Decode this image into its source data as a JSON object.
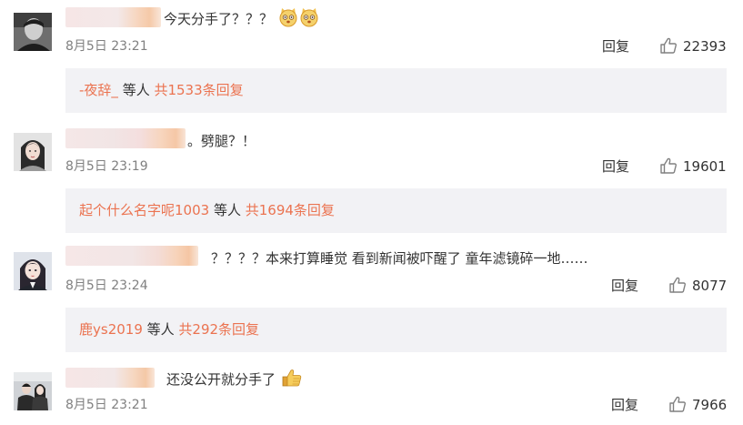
{
  "comments": [
    {
      "text": "今天分手了？？？",
      "timestamp": "8月5日 23:21",
      "reply_label": "回复",
      "likes": "22393",
      "emoji": [
        "cat-face-icon",
        "cat-face-icon"
      ],
      "replies_preview": {
        "user": "-夜辞_",
        "middle": " 等人 ",
        "total": "共1533条回复"
      }
    },
    {
      "text": "。劈腿？！",
      "timestamp": "8月5日 23:19",
      "reply_label": "回复",
      "likes": "19601",
      "replies_preview": {
        "user": "起个什么名字呢1003",
        "middle": " 等人 ",
        "total": "共1694条回复"
      }
    },
    {
      "text": "？？？？本来打算睡觉 看到新闻被吓醒了 童年滤镜碎一地……",
      "timestamp": "8月5日 23:24",
      "reply_label": "回复",
      "likes": "8077",
      "replies_preview": {
        "user": "鹿ys2019",
        "middle": " 等人 ",
        "total": "共292条回复"
      }
    },
    {
      "text": "还没公开就分手了",
      "timestamp": "8月5日 23:21",
      "reply_label": "回复",
      "likes": "7966",
      "emoji": [
        "thumbs-up-icon"
      ]
    }
  ],
  "colors": {
    "link": "#eb7350",
    "text": "#333333",
    "meta": "#808080",
    "reply_bg": "#f2f2f5",
    "blur_peach": "#f6d8c2",
    "blur_pink": "#f3e4e3"
  }
}
